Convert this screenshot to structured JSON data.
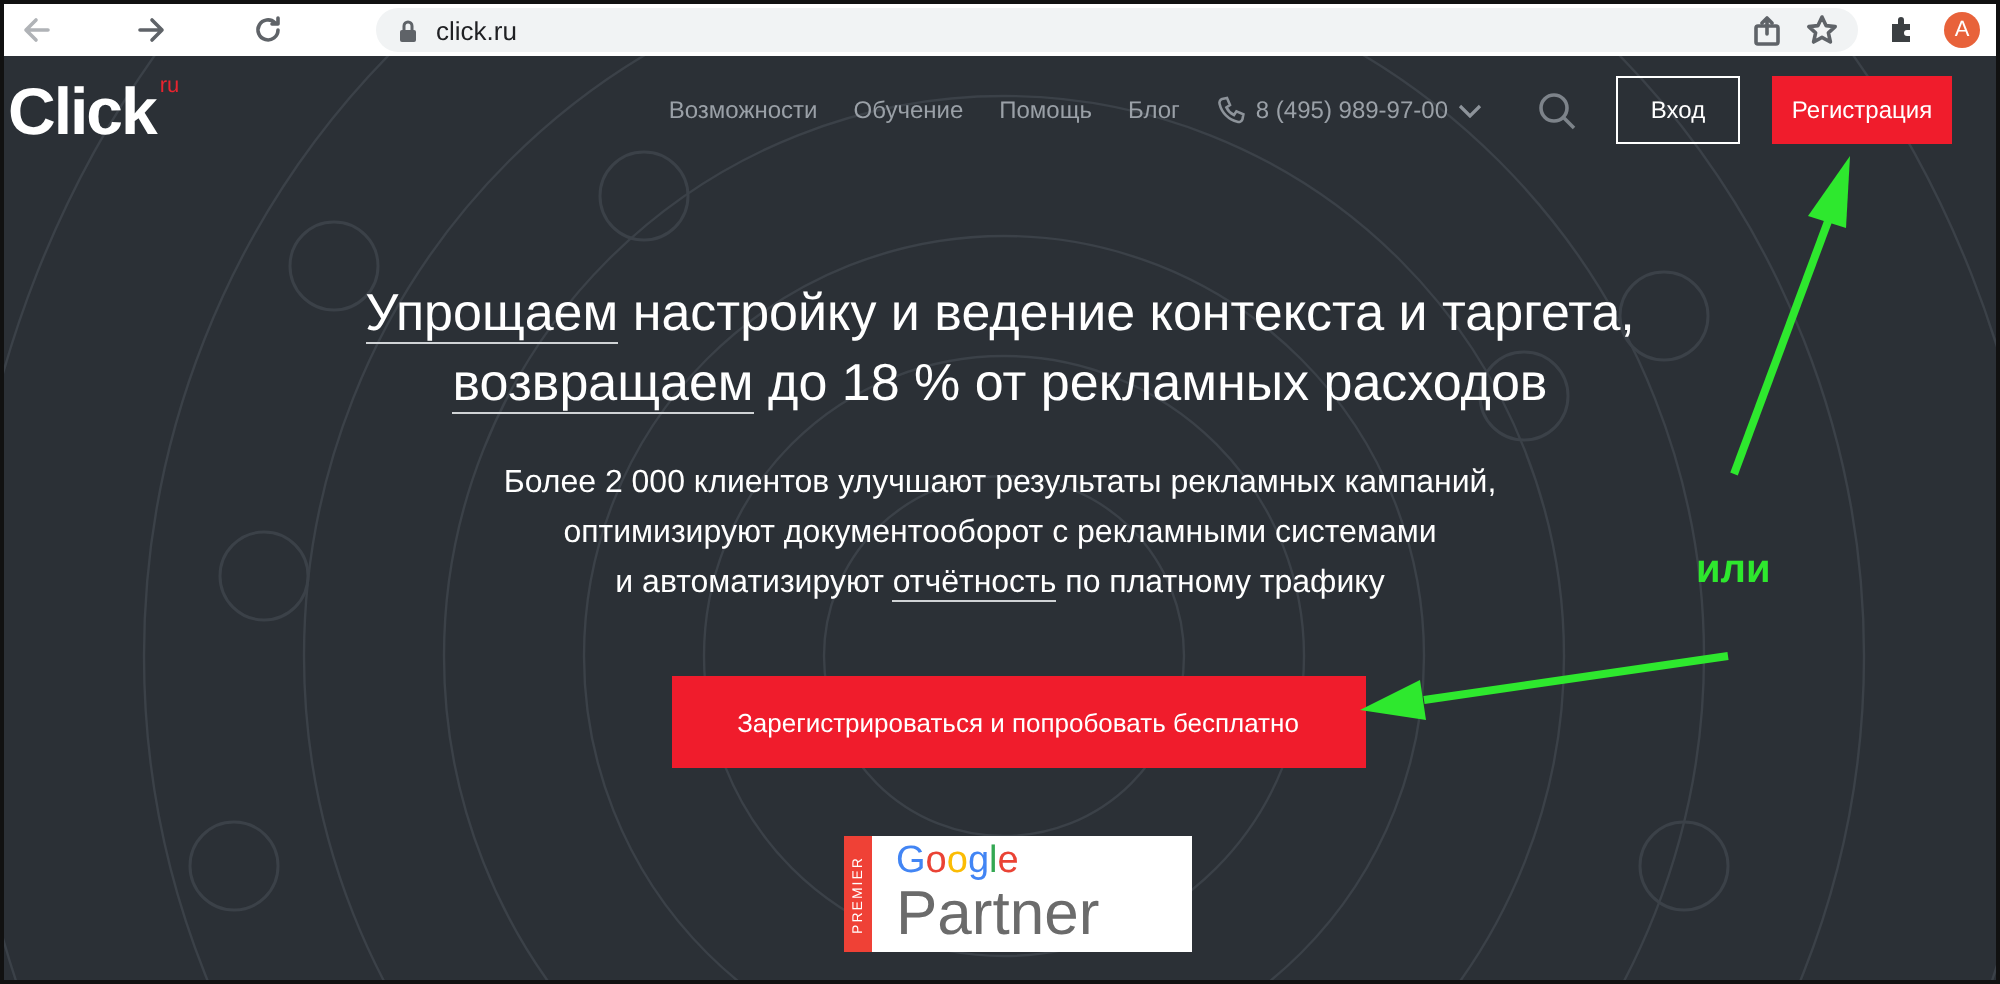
{
  "browser": {
    "url": "click.ru",
    "profile_initial": "A"
  },
  "header": {
    "logo": "Click",
    "logo_suffix": "ru",
    "nav": [
      {
        "label": "Возможности"
      },
      {
        "label": "Обучение"
      },
      {
        "label": "Помощь"
      },
      {
        "label": "Блог"
      }
    ],
    "phone": "8 (495) 989-97-00",
    "login": "Вход",
    "register": "Регистрация"
  },
  "hero": {
    "headline_lines": [
      [
        {
          "text": "Упрощаем",
          "underlined": true
        },
        {
          "text": " настройку и ведение контекста и таргета,",
          "underlined": false
        }
      ],
      [
        {
          "text": "возвращаем",
          "underlined": true
        },
        {
          "text": " до 18 % от рекламных расходов",
          "underlined": false
        }
      ]
    ],
    "subtitle_lines": [
      [
        {
          "text": "Более 2 000 клиентов улучшают результаты рекламных кампаний,",
          "underlined": false
        }
      ],
      [
        {
          "text": "оптимизируют документооборот с рекламными системами",
          "underlined": false
        }
      ],
      [
        {
          "text": "и автоматизируют ",
          "underlined": false
        },
        {
          "text": "отчётность",
          "underlined": true
        },
        {
          "text": " по платному трафику",
          "underlined": false
        }
      ]
    ],
    "cta": "Зарегистрироваться и попробовать бесплатно",
    "badge": {
      "ribbon": "PREMIER",
      "brand": "Google",
      "label": "Partner"
    }
  },
  "annotation": {
    "text": "или"
  }
}
